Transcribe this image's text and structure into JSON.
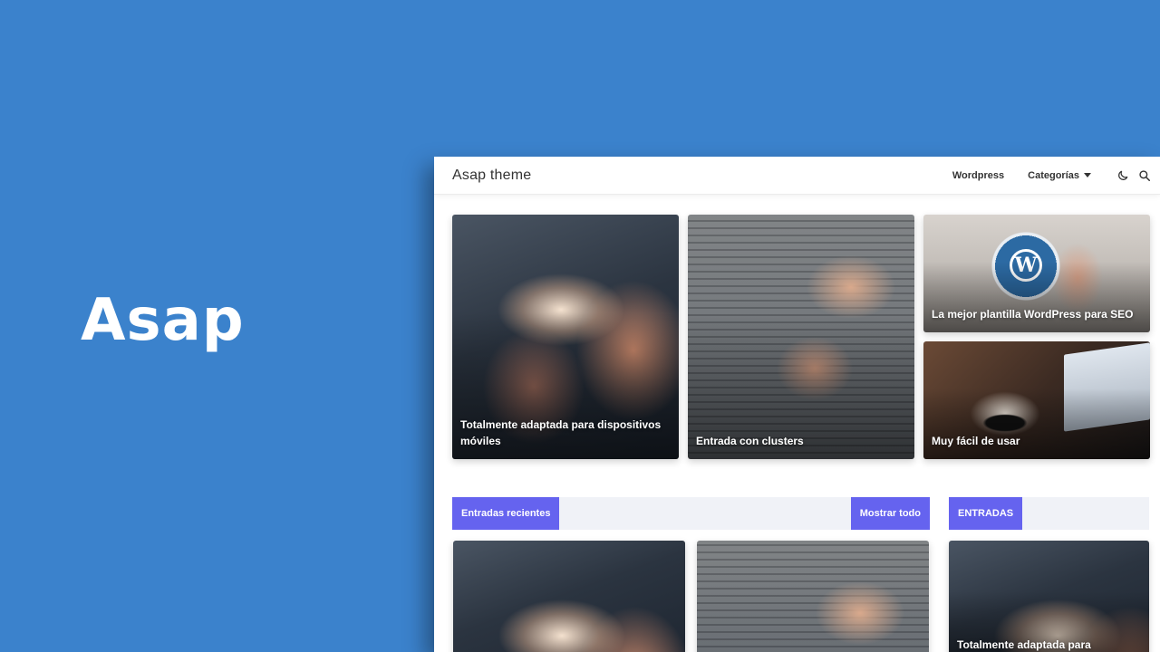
{
  "hero": {
    "title": "Asap"
  },
  "site": {
    "brand": "Asap theme",
    "nav": {
      "wordpress": "Wordpress",
      "categories": "Categorías"
    }
  },
  "featured": [
    {
      "title": "Totalmente adaptada para dispositivos móviles"
    },
    {
      "title": "Entrada con clusters"
    },
    {
      "title": "La mejor plantilla WordPress para SEO"
    },
    {
      "title": "Muy fácil de usar"
    }
  ],
  "sections": {
    "recent_label": "Entradas recientes",
    "show_all_label": "Mostrar todo",
    "entries_label": "ENTRADAS"
  },
  "sidebar_posts": [
    {
      "title": "Totalmente adaptada para dispositivos móviles"
    }
  ],
  "icons": {
    "theme_toggle": "moon-icon",
    "search": "search-icon",
    "dropdown": "caret-down-icon"
  },
  "colors": {
    "background": "#3b82cc",
    "accent": "#6563ef"
  }
}
